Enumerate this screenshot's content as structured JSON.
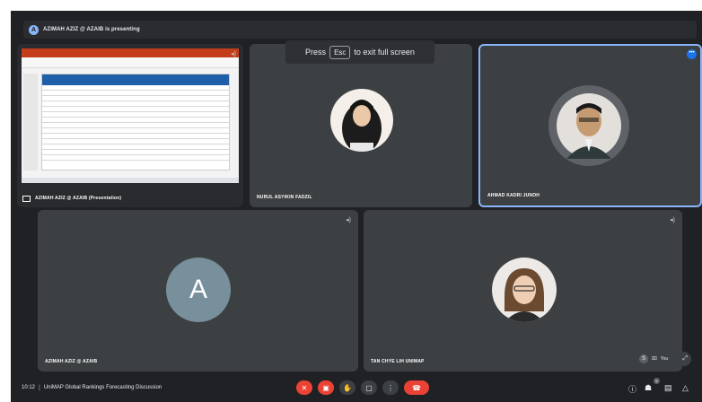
{
  "share_banner": {
    "text": "AZIMAH AZIZ @ AZAIB is presenting"
  },
  "fullscreen_toast": {
    "before": "Press",
    "key": "Esc",
    "after": "to exit full screen"
  },
  "tiles": [
    {
      "name": "AZIMAH AZIZ @ AZAIB (Presentation)",
      "kind": "presentation"
    },
    {
      "name": "NURUL ASYIKIN FADZIL",
      "kind": "photo"
    },
    {
      "name": "AHMAD KADRI JUNOH",
      "kind": "photo",
      "active_speaker": true
    },
    {
      "name": "AZIMAH AZIZ @ AZAIB",
      "kind": "letter",
      "letter": "A"
    },
    {
      "name": "TAN CHYE LIH UNIMAP",
      "kind": "photo"
    }
  ],
  "self_view": {
    "label": "You"
  },
  "meeting": {
    "time": "10:12",
    "separator": "|",
    "title": "UniMAP Global Rankings Forecasting Discussion"
  },
  "people_count": "5",
  "colors": {
    "background": "#202124",
    "tile": "#3c4043",
    "accent": "#8ab4f8",
    "danger": "#ea4335",
    "avatar": "#78909c"
  },
  "icons": [
    "mic-off-icon",
    "camera-off-icon",
    "raise-hand-icon",
    "present-icon",
    "more-options-icon",
    "hang-up-icon",
    "info-icon",
    "people-icon",
    "chat-icon",
    "activities-icon",
    "pin-icon",
    "fullscreen-icon"
  ]
}
